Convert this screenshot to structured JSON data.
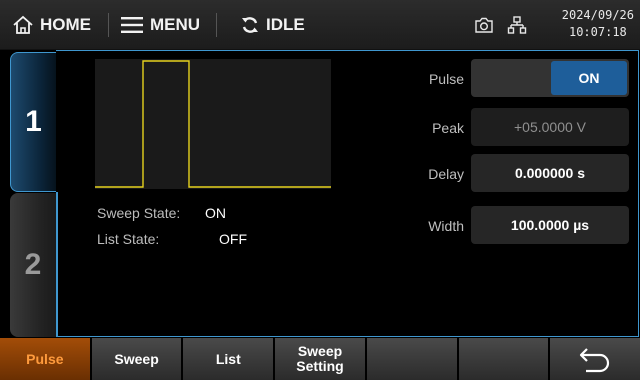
{
  "topbar": {
    "home_label": "HOME",
    "menu_label": "MENU",
    "status_label": "IDLE",
    "date": "2024/09/26",
    "time": "10:07:18"
  },
  "channels": {
    "ch1_label": "1",
    "ch2_label": "2"
  },
  "states": {
    "sweep_label": "Sweep State:",
    "sweep_value": "ON",
    "list_label": "List State:",
    "list_value": "OFF"
  },
  "params": {
    "pulse_label": "Pulse",
    "pulse_value": "ON",
    "peak_label": "Peak",
    "peak_value": "+05.0000 V",
    "delay_label": "Delay",
    "delay_value": "0.000000 s",
    "width_label": "Width",
    "width_value": "100.0000 µs"
  },
  "softkeys": {
    "k1": "Pulse",
    "k2": "Sweep",
    "k3": "List",
    "k4a": "Sweep",
    "k4b": "Setting",
    "k5": "",
    "k6": "",
    "k7": ""
  },
  "colors": {
    "accent": "#3f97cf",
    "active_softkey_text": "#ff9b3d",
    "waveform": "#e6d21e"
  }
}
